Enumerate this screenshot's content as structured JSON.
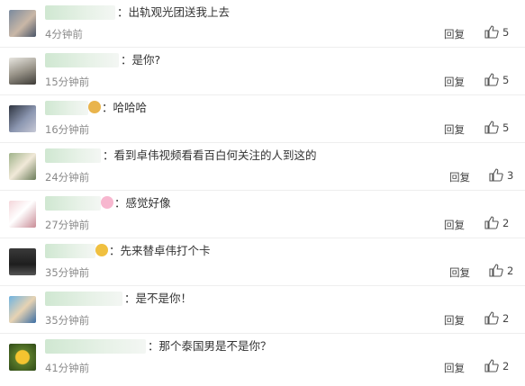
{
  "comments": [
    {
      "text": "：出轨观光团送我上去",
      "time": "4分钟前",
      "reply": "回复",
      "likes": "5"
    },
    {
      "text": "：是你?",
      "time": "15分钟前",
      "reply": "回复",
      "likes": "5"
    },
    {
      "text": "：哈哈哈",
      "time": "16分钟前",
      "reply": "回复",
      "likes": "5"
    },
    {
      "text": "：看到卓伟视频看看百白何关注的人到这的",
      "time": "24分钟前",
      "reply": "回复",
      "likes": "3"
    },
    {
      "text": "：感觉好像",
      "time": "27分钟前",
      "reply": "回复",
      "likes": "2"
    },
    {
      "text": "：先来替卓伟打个卡",
      "time": "35分钟前",
      "reply": "回复",
      "likes": "2"
    },
    {
      "text": "：是不是你！",
      "time": "35分钟前",
      "reply": "回复",
      "likes": "2"
    },
    {
      "text": "：那个泰国男是不是你？",
      "time": "41分钟前",
      "reply": "回复",
      "likes": "2"
    }
  ],
  "icons": {
    "like": "thumbs-up-icon"
  },
  "colors": {
    "text": "#333333",
    "time": "#8a8a8a",
    "divider": "#eeeeee"
  }
}
